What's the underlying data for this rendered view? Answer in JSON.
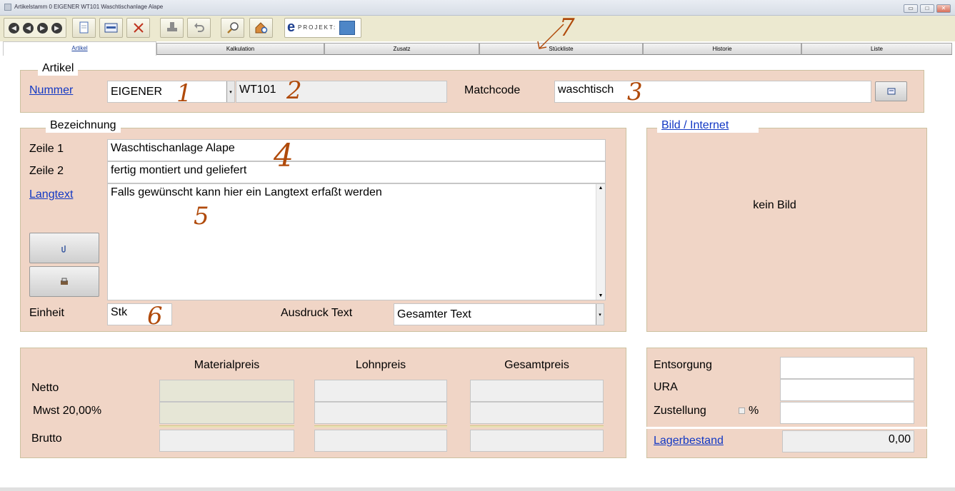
{
  "window": {
    "title": "Artikelstamm 0 EIGENER   WT101  Waschtischanlage Alape",
    "controls": {
      "minimize": "▭",
      "maximize": "□",
      "close": "✕"
    }
  },
  "toolbar": {
    "nav_first": "◀",
    "nav_prev": "◀",
    "nav_next": "▶",
    "nav_last": "▶",
    "icons": [
      "new-document-icon",
      "edit-card-icon",
      "delete-icon",
      "stamp-icon",
      "undo-icon",
      "search-icon",
      "home-search-icon"
    ],
    "eprojekt_label": "PROJEKT:",
    "eprojekt_e": "e"
  },
  "tabs": [
    {
      "label": "Artikel",
      "active": true
    },
    {
      "label": "Kalkulation",
      "active": false
    },
    {
      "label": "Zusatz",
      "active": false
    },
    {
      "label": "Stückliste",
      "active": false
    },
    {
      "label": "Historie",
      "active": false
    },
    {
      "label": "Liste",
      "active": false
    }
  ],
  "artikel": {
    "legend": "Artikel",
    "nummer_label": "Nummer",
    "nummer_prefix": "EIGENER",
    "nummer_value": "WT101",
    "matchcode_label": "Matchcode",
    "matchcode_value": "waschtisch"
  },
  "bezeichnung": {
    "legend": "Bezeichnung",
    "zeile1_label": "Zeile 1",
    "zeile1_value": "Waschtischanlage Alape",
    "zeile2_label": "Zeile 2",
    "zeile2_value": "fertig montiert und geliefert",
    "langtext_label": "Langtext",
    "langtext_value": "Falls gewünscht kann hier ein Langtext erfaßt werden",
    "einheit_label": "Einheit",
    "einheit_value": "Stk",
    "ausdruck_label": "Ausdruck Text",
    "ausdruck_value": "Gesamter Text"
  },
  "bild": {
    "legend": "Bild / Internet",
    "placeholder": "kein Bild"
  },
  "preise": {
    "col_material": "Materialpreis",
    "col_lohn": "Lohnpreis",
    "col_gesamt": "Gesamtpreis",
    "row_netto": "Netto",
    "row_mwst": "Mwst 20,00%",
    "row_brutto": "Brutto"
  },
  "extras": {
    "entsorgung_label": "Entsorgung",
    "ura_label": "URA",
    "zustellung_label": "Zustellung",
    "percent_label": "%",
    "lagerbestand_label": "Lagerbestand",
    "lagerbestand_value": "0,00"
  },
  "annotations": {
    "n1": "1",
    "n2": "2",
    "n3": "3",
    "n4": "4",
    "n5": "5",
    "n6": "6",
    "n7": "7"
  }
}
